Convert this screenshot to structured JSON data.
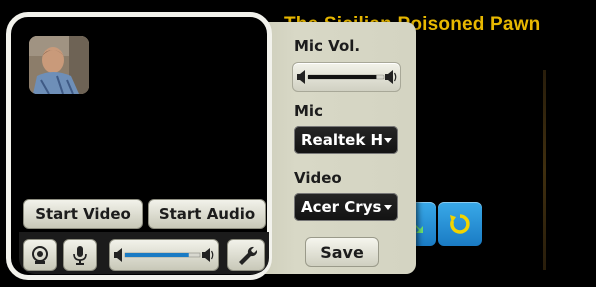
{
  "background": {
    "title": "The Sicilian Poisoned Pawn"
  },
  "settings": {
    "mic_vol_label": "Mic Vol.",
    "mic_label": "Mic",
    "mic_value": "Realtek H",
    "video_label": "Video",
    "video_value": "Acer Crys",
    "save_label": "Save",
    "mic_volume_level": 0.9
  },
  "video_panel": {
    "start_video_label": "Start Video",
    "start_audio_label": "Start Audio",
    "volume_level": 0.85
  },
  "icons": {
    "webcam": "webcam-icon",
    "microphone": "microphone-icon",
    "speaker_low": "speaker-low-icon",
    "speaker_high": "speaker-high-icon",
    "wrench": "wrench-icon",
    "refresh": "refresh-icon",
    "move": "move-icon"
  },
  "colors": {
    "accent_blue": "#1a7bc4",
    "title_yellow": "#e8b800",
    "panel_bg": "#d4d4c2"
  }
}
